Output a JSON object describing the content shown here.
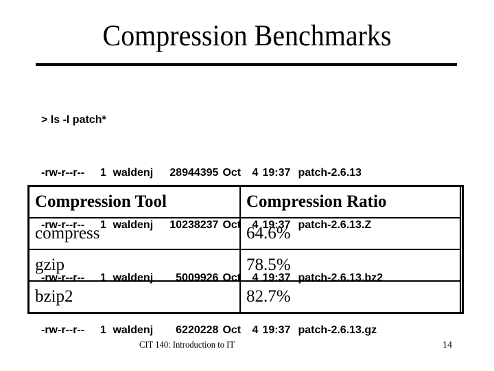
{
  "slide": {
    "title": "Compression Benchmarks",
    "footer": "CIT 140: Introduction to IT",
    "page_number": "14"
  },
  "listing": {
    "command": "> ls -l patch*",
    "files": [
      {
        "perms": "-rw-r--r--",
        "links": "1",
        "owner": "waldenj",
        "size": "28944395",
        "month": "Oct",
        "day": "4",
        "time": "19:37",
        "name": "patch-2.6.13"
      },
      {
        "perms": "-rw-r--r--",
        "links": "1",
        "owner": "waldenj",
        "size": "10238237",
        "month": "Oct",
        "day": "4",
        "time": "19:37",
        "name": "patch-2.6.13.Z"
      },
      {
        "perms": "-rw-r--r--",
        "links": "1",
        "owner": "waldenj",
        "size": "5009926",
        "month": "Oct",
        "day": "4",
        "time": "19:37",
        "name": "patch-2.6.13.bz2"
      },
      {
        "perms": "-rw-r--r--",
        "links": "1",
        "owner": "waldenj",
        "size": "6220228",
        "month": "Oct",
        "day": "4",
        "time": "19:37",
        "name": "patch-2.6.13.gz"
      }
    ]
  },
  "table": {
    "headers": [
      "Compression Tool",
      "Compression Ratio"
    ],
    "rows": [
      [
        "compress",
        "64.6%"
      ],
      [
        "gzip",
        "78.5%"
      ],
      [
        "bzip2",
        "82.7%"
      ]
    ]
  }
}
